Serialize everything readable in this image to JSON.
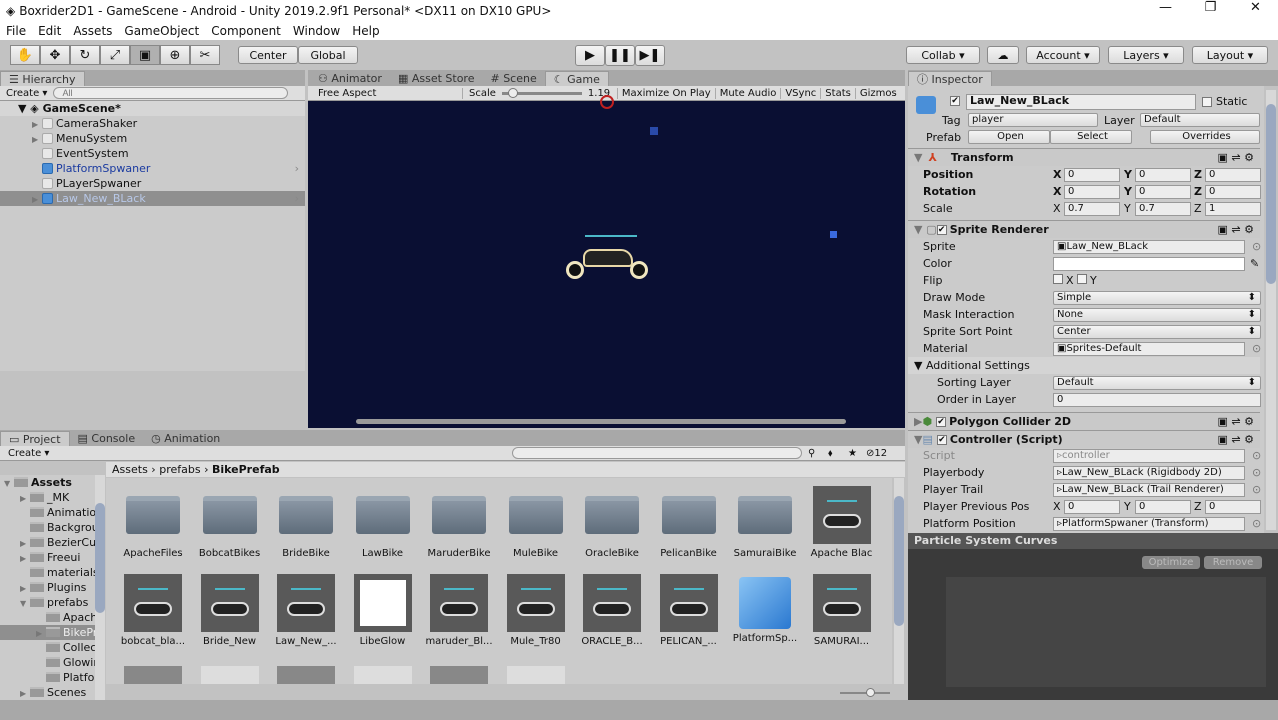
{
  "window": {
    "title": "Boxrider2D1 - GameScene - Android - Unity 2019.2.9f1 Personal* <DX11 on DX10 GPU>",
    "minimize": "—",
    "maximize": "❐",
    "close": "✕"
  },
  "menu": [
    "File",
    "Edit",
    "Assets",
    "GameObject",
    "Component",
    "Window",
    "Help"
  ],
  "toolbar": {
    "tools": [
      "hand-tool",
      "move-tool",
      "rotate-tool",
      "scale-tool",
      "rect-tool",
      "transform-tool",
      "custom-tool"
    ],
    "pivot": "Center",
    "space": "Global",
    "collab": "Collab",
    "account": "Account",
    "layers": "Layers",
    "layout": "Layout"
  },
  "hierarchy": {
    "tab": "Hierarchy",
    "create": "Create",
    "search_placeholder": "All",
    "scene": "GameScene*",
    "items": [
      {
        "label": "CameraShaker",
        "expandable": true,
        "prefab": false
      },
      {
        "label": "MenuSystem",
        "expandable": true,
        "prefab": false
      },
      {
        "label": "EventSystem",
        "expandable": false,
        "prefab": false
      },
      {
        "label": "PlatformSpwaner",
        "expandable": false,
        "prefab": true
      },
      {
        "label": "PLayerSpwaner",
        "expandable": false,
        "prefab": false
      },
      {
        "label": "Law_New_BLack",
        "expandable": true,
        "prefab": true,
        "selected": true
      }
    ]
  },
  "center_tabs": [
    "Animator",
    "Asset Store",
    "Scene",
    "Game"
  ],
  "game": {
    "aspect": "Free Aspect",
    "scale_label": "Scale",
    "scale_value": "1.19",
    "buttons": [
      "Maximize On Play",
      "Mute Audio",
      "VSync",
      "Stats",
      "Gizmos"
    ],
    "background": "#0a0f33"
  },
  "inspector": {
    "tab": "Inspector",
    "name": "Law_New_BLack",
    "static": "Static",
    "tag_label": "Tag",
    "tag": "player",
    "layer_label": "Layer",
    "layer": "Default",
    "prefab_label": "Prefab",
    "open": "Open",
    "select": "Select",
    "overrides": "Overrides",
    "transform": {
      "title": "Transform",
      "rows": [
        {
          "label": "Position",
          "x": "0",
          "y": "0",
          "z": "0"
        },
        {
          "label": "Rotation",
          "x": "0",
          "y": "0",
          "z": "0"
        },
        {
          "label": "Scale",
          "x": "0.7",
          "y": "0.7",
          "z": "1"
        }
      ]
    },
    "sprite_renderer": {
      "title": "Sprite Renderer",
      "sprite_label": "Sprite",
      "sprite": "Law_New_BLack",
      "color_label": "Color",
      "flip_label": "Flip",
      "flip_x": "X",
      "flip_y": "Y",
      "draw_mode_label": "Draw Mode",
      "draw_mode": "Simple",
      "mask_label": "Mask Interaction",
      "mask": "None",
      "sort_point_label": "Sprite Sort Point",
      "sort_point": "Center",
      "material_label": "Material",
      "material": "Sprites-Default",
      "additional": "Additional Settings",
      "sorting_layer_label": "Sorting Layer",
      "sorting_layer": "Default",
      "order_label": "Order in Layer",
      "order": "0"
    },
    "polygon_collider": {
      "title": "Polygon Collider 2D"
    },
    "controller": {
      "title": "Controller (Script)",
      "script_label": "Script",
      "script": "controller",
      "playerbody_label": "Playerbody",
      "playerbody": "Law_New_BLack (Rigidbody 2D)",
      "trail_label": "Player Trail",
      "trail": "Law_New_BLack (Trail Renderer)",
      "prev_label": "Player Previous Pos",
      "prev_x": "0",
      "prev_y": "0",
      "prev_z": "0",
      "platform_label": "Platform Position",
      "platform": "PlatformSpwaner (Transform)"
    }
  },
  "particle_curves": {
    "title": "Particle System Curves",
    "optimize": "Optimize",
    "remove": "Remove"
  },
  "project": {
    "tabs": [
      "Project",
      "Console",
      "Animation"
    ],
    "create": "Create",
    "hidden_count": "12",
    "breadcrumb": [
      "Assets",
      "prefabs",
      "BikePrefab"
    ],
    "tree": [
      {
        "label": "Assets",
        "depth": 0,
        "arrow": "▼",
        "bold": true
      },
      {
        "label": "_MK",
        "depth": 1,
        "arrow": "▶"
      },
      {
        "label": "Animation",
        "depth": 1,
        "arrow": ""
      },
      {
        "label": "Background",
        "depth": 1,
        "arrow": ""
      },
      {
        "label": "BezierCurve",
        "depth": 1,
        "arrow": "▶"
      },
      {
        "label": "Freeui",
        "depth": 1,
        "arrow": "▶"
      },
      {
        "label": "materials",
        "depth": 1,
        "arrow": ""
      },
      {
        "label": "Plugins",
        "depth": 1,
        "arrow": "▶"
      },
      {
        "label": "prefabs",
        "depth": 1,
        "arrow": "▼"
      },
      {
        "label": "Apache",
        "depth": 2,
        "arrow": ""
      },
      {
        "label": "BikePrefab",
        "depth": 2,
        "arrow": "▶",
        "selected": true
      },
      {
        "label": "Collect",
        "depth": 2,
        "arrow": ""
      },
      {
        "label": "Glowing",
        "depth": 2,
        "arrow": ""
      },
      {
        "label": "Platform",
        "depth": 2,
        "arrow": ""
      },
      {
        "label": "Scenes",
        "depth": 1,
        "arrow": "▶"
      }
    ],
    "row1": [
      "ApacheFiles",
      "BobcatBikes",
      "BrideBike",
      "LawBike",
      "MaruderBike",
      "MuleBike",
      "OracleBike",
      "PelicanBike",
      "SamuraiBike",
      "Apache Blac"
    ],
    "row2": [
      "bobcat_bla...",
      "Bride_New",
      "Law_New_...",
      "LibeGlow",
      "maruder_Bl...",
      "Mule_Tr80",
      "ORACLE_B...",
      "PELICAN_...",
      "PlatformSp...",
      "SAMURAI..."
    ]
  }
}
